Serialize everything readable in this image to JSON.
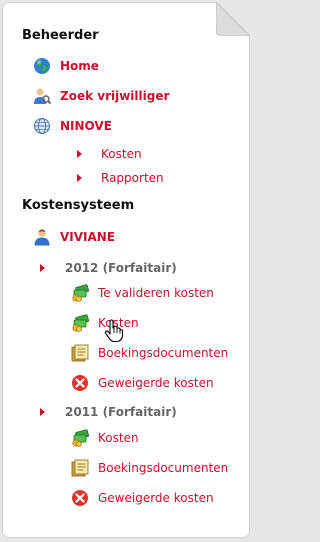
{
  "sections": {
    "beheerder": "Beheerder",
    "kostensysteem": "Kostensysteem"
  },
  "menu": {
    "home": "Home",
    "zoek": "Zoek vrijwilliger",
    "ninove": "NINOVE",
    "ninove_kosten": "Kosten",
    "ninove_rapporten": "Rapporten",
    "user": "VIVIANE",
    "year2012": "2012 (Forfaitair)",
    "y2012_valideren": "Te valideren kosten",
    "y2012_kosten": "Kosten",
    "y2012_boekings": "Boekingsdocumenten",
    "y2012_geweigerd": "Geweigerde kosten",
    "year2011": "2011 (Forfaitair)",
    "y2011_kosten": "Kosten",
    "y2011_boekings": "Boekingsdocumenten",
    "y2011_geweigerd": "Geweigerde kosten"
  },
  "colors": {
    "link": "#c8102e",
    "year": "#666666",
    "heading": "#111111"
  },
  "icons": [
    "globe-icon",
    "user-search-icon",
    "web-globe-icon",
    "user-icon",
    "money-icon",
    "document-icon",
    "reject-icon",
    "hand-cursor-icon"
  ]
}
